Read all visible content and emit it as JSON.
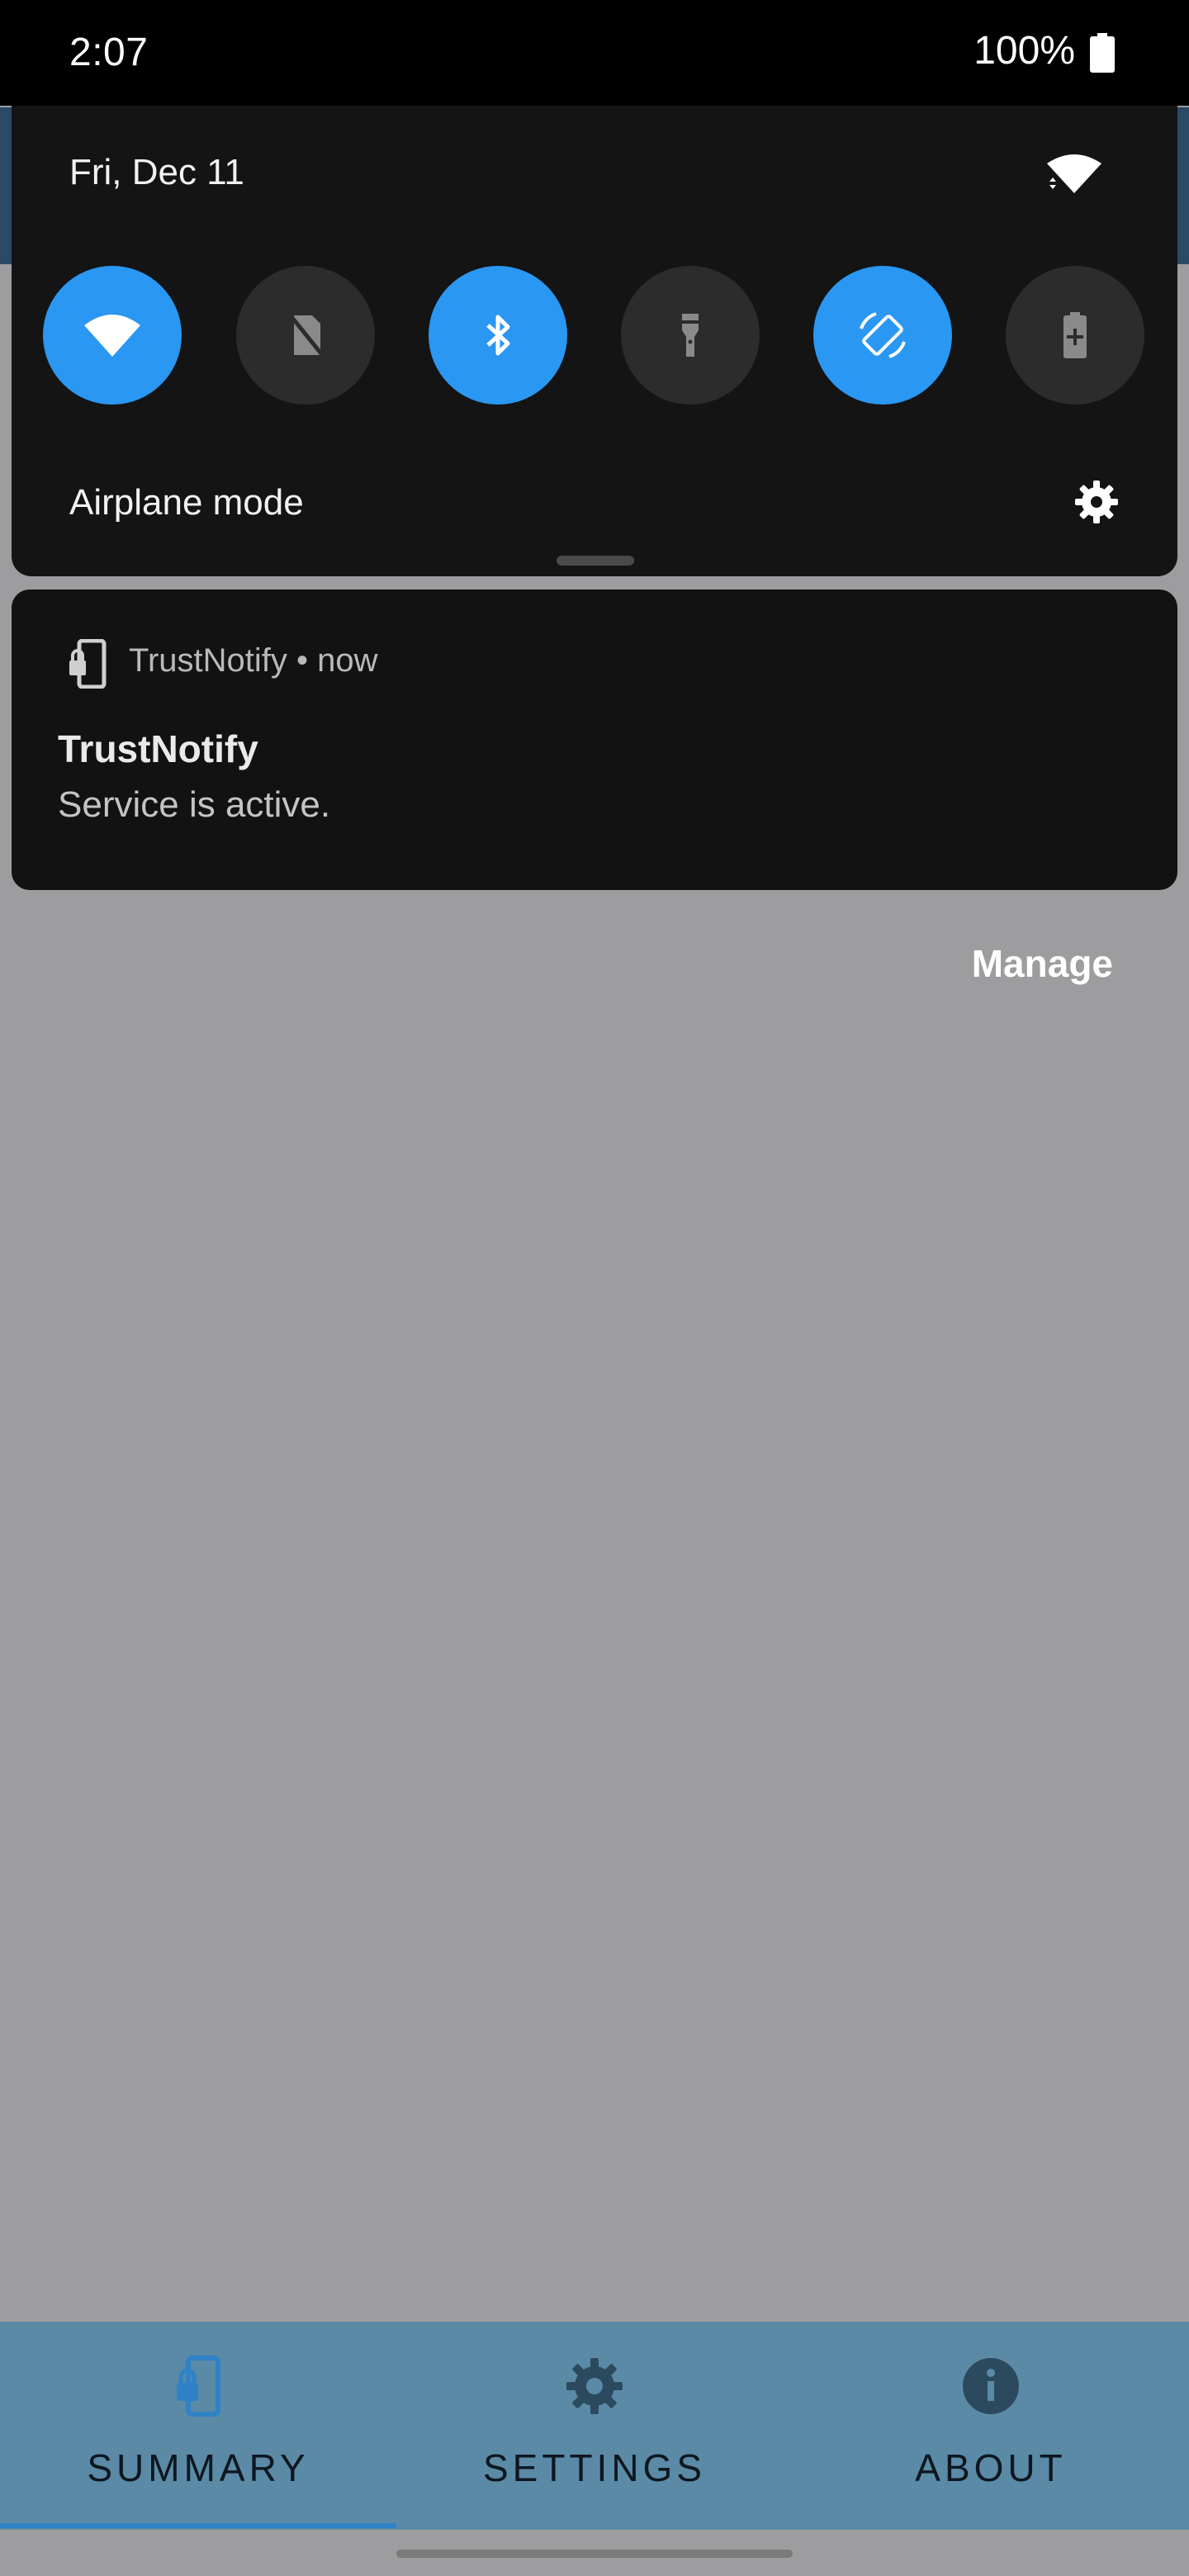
{
  "status_bar": {
    "time": "2:07",
    "battery": "100%"
  },
  "quick_settings": {
    "date": "Fri, Dec 11",
    "tiles": [
      {
        "name": "wifi",
        "state": "on"
      },
      {
        "name": "no-sim",
        "state": "off"
      },
      {
        "name": "bluetooth",
        "state": "on"
      },
      {
        "name": "flashlight",
        "state": "off"
      },
      {
        "name": "auto-rotate",
        "state": "on"
      },
      {
        "name": "battery-saver",
        "state": "off"
      }
    ],
    "label": "Airplane mode"
  },
  "notification": {
    "app": "TrustNotify",
    "time": "now",
    "title": "TrustNotify",
    "body": "Service is active."
  },
  "manage_label": "Manage",
  "bottom_nav": {
    "items": [
      {
        "label": "SUMMARY",
        "icon": "phone-lock-icon",
        "active": true
      },
      {
        "label": "SETTINGS",
        "icon": "gear-icon",
        "active": false
      },
      {
        "label": "ABOUT",
        "icon": "info-icon",
        "active": false
      }
    ]
  },
  "colors": {
    "accent": "#2a97f2",
    "nav_bg": "#5a8aa6",
    "panel_bg": "#141414"
  }
}
